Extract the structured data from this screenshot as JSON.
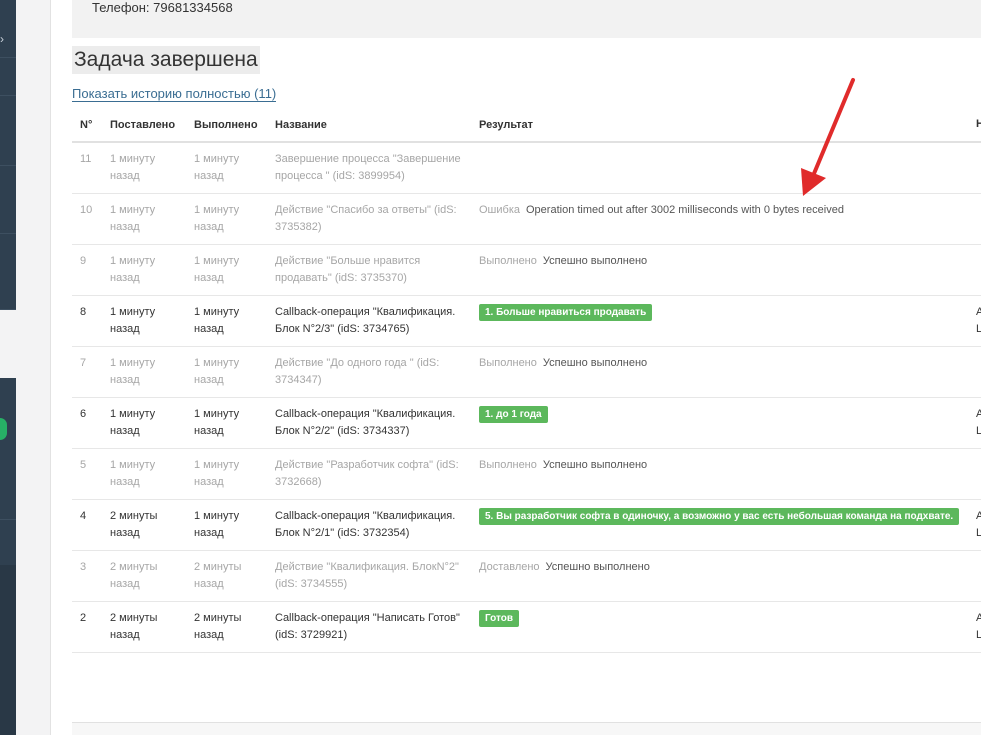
{
  "header": {
    "phone_text": "Телефон: 79681334568"
  },
  "page": {
    "title": "Задача завершена",
    "history_link": "Показать историю полностью (11)"
  },
  "table": {
    "columns": [
      "N°",
      "Поставлено",
      "Выполнено",
      "Название",
      "Результат"
    ],
    "rows": [
      {
        "n": "11",
        "set": "1 минуту назад",
        "done": "1 минуту назад",
        "name": "Завершение процесса \"Завершение процесса \" (idS: 3899954)",
        "status": "",
        "result": "",
        "badge": "",
        "muted": true
      },
      {
        "n": "10",
        "set": "1 минуту назад",
        "done": "1 минуту назад",
        "name": "Действие \"Спасибо за ответы\" (idS: 3735382)",
        "status": "Ошибка",
        "result": "Operation timed out after 3002 milliseconds with 0 bytes received",
        "badge": "",
        "muted": true
      },
      {
        "n": "9",
        "set": "1 минуту назад",
        "done": "1 минуту назад",
        "name": "Действие \"Больше нравится продавать\" (idS: 3735370)",
        "status": "Выполнено",
        "result": "Успешно выполнено",
        "badge": "",
        "muted": true
      },
      {
        "n": "8",
        "set": "1 минуту назад",
        "done": "1 минуту назад",
        "name": "Callback-операция \"Квалификация. Блок N°2/3\" (idS: 3734765)",
        "status": "",
        "result": "",
        "badge": "1. Больше нравиться продавать",
        "muted": false
      },
      {
        "n": "7",
        "set": "1 минуту назад",
        "done": "1 минуту назад",
        "name": "Действие \"До одного года \" (idS: 3734347)",
        "status": "Выполнено",
        "result": "Успешно выполнено",
        "badge": "",
        "muted": true
      },
      {
        "n": "6",
        "set": "1 минуту назад",
        "done": "1 минуту назад",
        "name": "Callback-операция \"Квалификация. Блок N°2/2\" (idS: 3734337)",
        "status": "",
        "result": "",
        "badge": "1. до 1 года",
        "muted": false
      },
      {
        "n": "5",
        "set": "1 минуту назад",
        "done": "1 минуту назад",
        "name": "Действие \"Разработчик софта\" (idS: 3732668)",
        "status": "Выполнено",
        "result": "Успешно выполнено",
        "badge": "",
        "muted": true
      },
      {
        "n": "4",
        "set": "2 минуты назад",
        "done": "1 минуту назад",
        "name": "Callback-операция \"Квалификация. Блок N°2/1\" (idS: 3732354)",
        "status": "",
        "result": "",
        "badge": "5. Вы разработчик софта в одиночку, а возможно у вас есть небольшая команда на подхвате.",
        "muted": false
      },
      {
        "n": "3",
        "set": "2 минуты назад",
        "done": "2 минуты назад",
        "name": "Действие \"Квалификация. БлокN°2\" (idS: 3734555)",
        "status": "Доставлено",
        "result": "Успешно выполнено",
        "badge": "",
        "muted": true
      },
      {
        "n": "2",
        "set": "2 минуты назад",
        "done": "2 минуты назад",
        "name": "Callback-операция \"Написать Готов\" (idS: 3729921)",
        "status": "",
        "result": "",
        "badge": "Готов",
        "muted": false
      }
    ]
  },
  "colors": {
    "badge_green": "#5cb85c",
    "annotation_arrow": "#e02b2b",
    "link_blue": "#3a6d92"
  }
}
